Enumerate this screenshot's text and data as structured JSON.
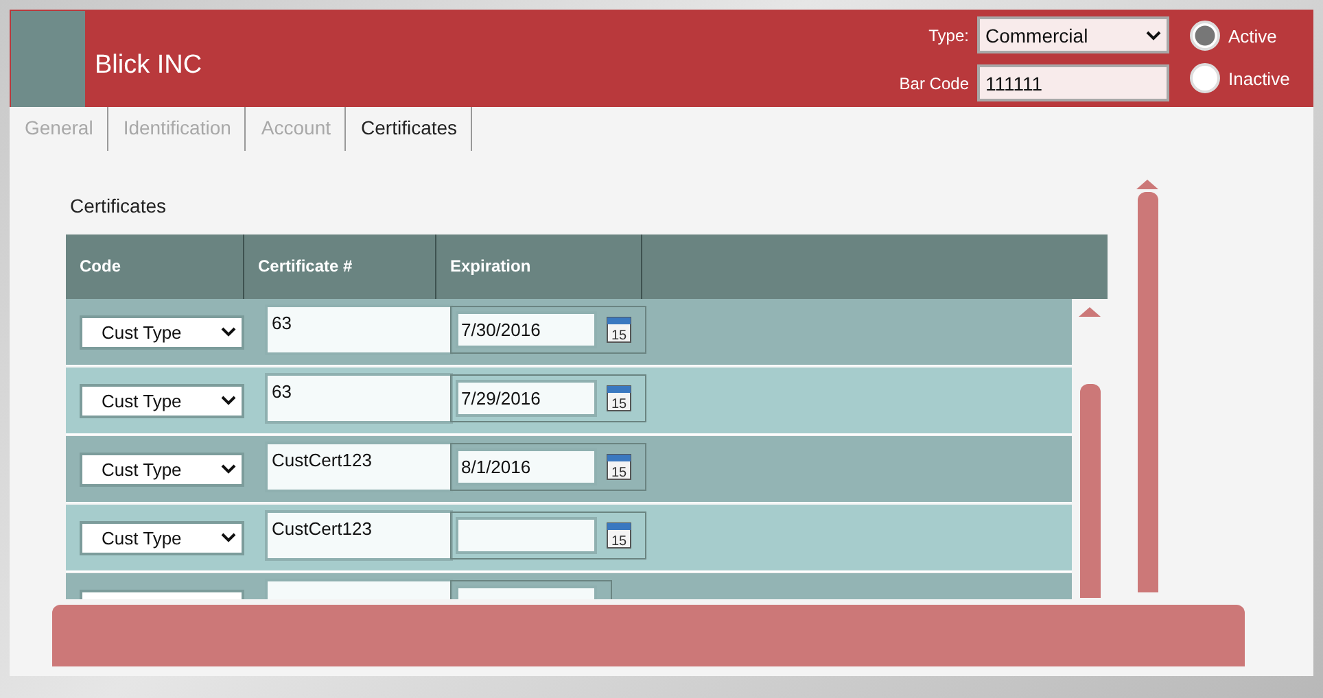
{
  "header": {
    "name": "Blick INC",
    "type_label": "Type:",
    "type_value": "Commercial",
    "barcode_label": "Bar Code",
    "barcode_value": "111111",
    "status": [
      {
        "label": "Active",
        "selected": true
      },
      {
        "label": "Inactive",
        "selected": false
      }
    ]
  },
  "tabs": [
    {
      "label": "General",
      "selected": false
    },
    {
      "label": "Identification",
      "selected": false
    },
    {
      "label": "Account",
      "selected": false
    },
    {
      "label": "Certificates",
      "selected": true
    }
  ],
  "section_title": "Certificates",
  "table": {
    "columns": [
      "Code",
      "Certificate #",
      "Expiration"
    ],
    "rows": [
      {
        "code": "Cust Type",
        "certificate": "63",
        "expiration": "7/30/2016",
        "calendar": "15"
      },
      {
        "code": "Cust Type",
        "certificate": "63",
        "expiration": "7/29/2016",
        "calendar": "15"
      },
      {
        "code": "Cust Type",
        "certificate": "CustCert123",
        "expiration": "8/1/2016",
        "calendar": "15"
      },
      {
        "code": "Cust Type",
        "certificate": "CustCert123",
        "expiration": "",
        "calendar": "15"
      }
    ],
    "partial_row": true
  }
}
